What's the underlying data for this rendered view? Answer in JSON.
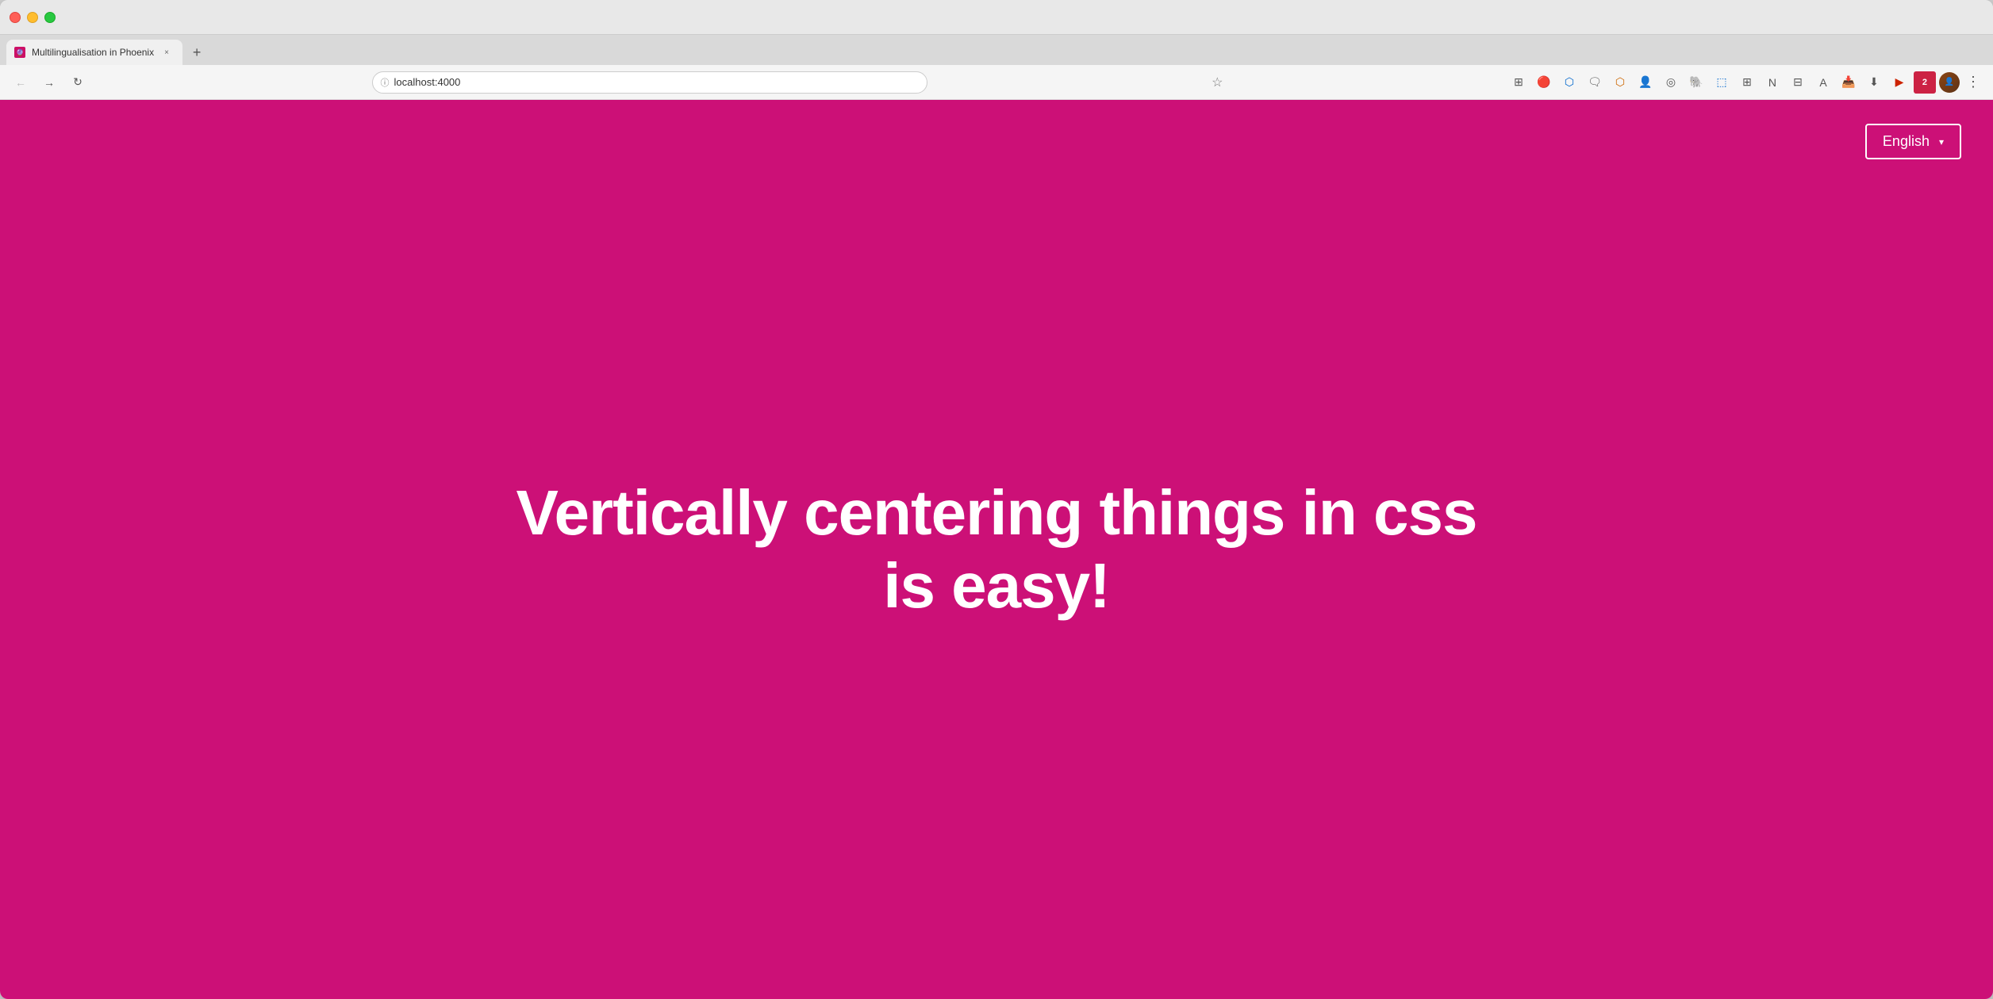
{
  "browser": {
    "title": "Multilingualisation in Phoenix",
    "url": "localhost:4000",
    "tab_close_label": "×",
    "new_tab_label": "+",
    "back_arrow": "←",
    "forward_arrow": "→",
    "refresh_icon": "↻"
  },
  "page": {
    "background_color": "#cc1077",
    "heading_line1": "Vertically centering things in css",
    "heading_line2": "is easy!",
    "language_button": "English",
    "language_dropdown_arrow": "▾"
  },
  "toolbar": {
    "bookmark_icon": "☆",
    "more_icon": "⋮"
  }
}
